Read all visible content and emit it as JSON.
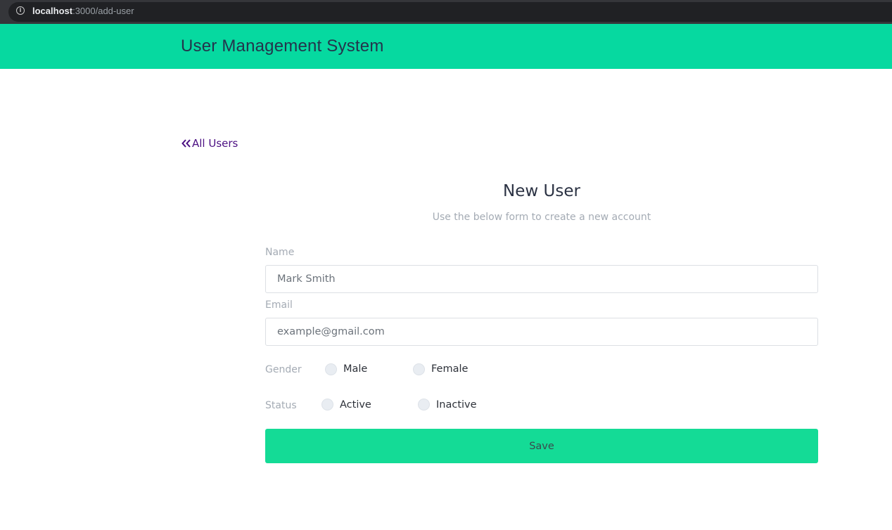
{
  "browser": {
    "url_host": "localhost",
    "url_path": ":3000/add-user"
  },
  "header": {
    "title": "User Management System"
  },
  "nav": {
    "back_label": "All Users"
  },
  "form": {
    "title": "New User",
    "subtitle": "Use the below form to create a new account",
    "name": {
      "label": "Name",
      "placeholder": "Mark Smith",
      "value": ""
    },
    "email": {
      "label": "Email",
      "placeholder": "example@gmail.com",
      "value": ""
    },
    "gender": {
      "label": "Gender",
      "options": [
        "Male",
        "Female"
      ],
      "selected": null
    },
    "status": {
      "label": "Status",
      "options": [
        "Active",
        "Inactive"
      ],
      "selected": null
    },
    "save_label": "Save"
  },
  "colors": {
    "header_bg": "#06d9a0",
    "button_bg": "#14db96",
    "link": "#4b0f82"
  },
  "icons": {
    "info": "info-icon",
    "back": "double-chevron-left-icon"
  }
}
